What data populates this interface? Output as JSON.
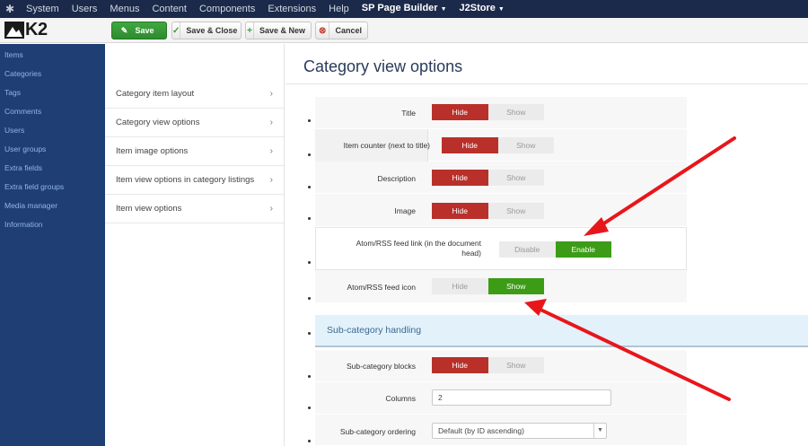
{
  "topbar": {
    "logo_icon": "joomla-icon",
    "items": [
      "System",
      "Users",
      "Menus",
      "Content",
      "Components",
      "Extensions",
      "Help"
    ],
    "sp_page_builder": "SP Page Builder",
    "j2store": "J2Store"
  },
  "header": {
    "logo_text": "K2",
    "save": "Save",
    "save_close": "Save & Close",
    "save_new": "Save & New",
    "cancel": "Cancel"
  },
  "sidebar": {
    "items": [
      "Items",
      "Categories",
      "Tags",
      "Comments",
      "Users",
      "User groups",
      "Extra fields",
      "Extra field groups",
      "Media manager",
      "Information"
    ]
  },
  "subnav": {
    "items": [
      "Category item layout",
      "Category view options",
      "Item image options",
      "Item view options in category listings",
      "Item view options"
    ]
  },
  "main": {
    "title": "Category view options",
    "hide": "Hide",
    "show": "Show",
    "disable": "Disable",
    "enable": "Enable",
    "options": {
      "title": "Title",
      "item_counter": "Item counter (next to title)",
      "description": "Description",
      "image": "Image",
      "feed_link_line1": "Atom/RSS feed link (in the document",
      "feed_link_line2": "head)",
      "feed_icon": "Atom/RSS feed icon"
    },
    "section": "Sub-category handling",
    "subcat_blocks": "Sub-category blocks",
    "columns": "Columns",
    "columns_value": "2",
    "subcat_ordering": "Sub-category ordering",
    "subcat_ordering_value": "Default (by ID ascending)"
  },
  "colors": {
    "accent_red": "#b9302a",
    "accent_green": "#3c9c16",
    "sidebar_bg": "#1f3f74",
    "annotation_arrow": "#e8161b"
  }
}
